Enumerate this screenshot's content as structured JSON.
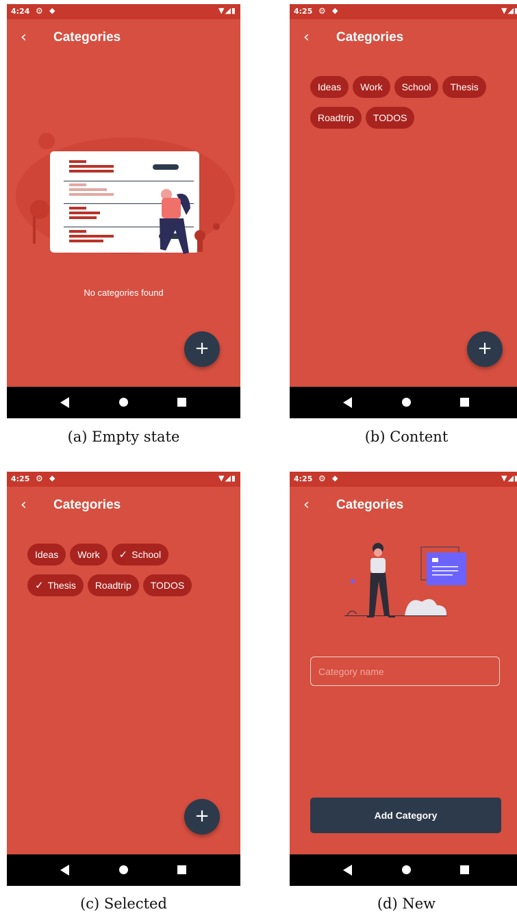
{
  "screens": [
    {
      "status_time": "4:24",
      "title": "Categories",
      "empty_message": "No categories found",
      "caption": "(a) Empty state",
      "fab_label": "+"
    },
    {
      "status_time": "4:25",
      "title": "Categories",
      "chips": [
        "Ideas",
        "Work",
        "School",
        "Thesis",
        "Roadtrip",
        "TODOS"
      ],
      "caption": "(b) Content",
      "fab_label": "+"
    },
    {
      "status_time": "4:25",
      "title": "Categories",
      "chips": [
        {
          "label": "Ideas",
          "selected": false
        },
        {
          "label": "Work",
          "selected": false
        },
        {
          "label": "School",
          "selected": true
        },
        {
          "label": "Thesis",
          "selected": true
        },
        {
          "label": "Roadtrip",
          "selected": false
        },
        {
          "label": "TODOS",
          "selected": false
        }
      ],
      "caption": "(c) Selected",
      "fab_label": "+"
    },
    {
      "status_time": "4:25",
      "title": "Categories",
      "input_placeholder": "Category name",
      "input_value": "",
      "add_button_label": "Add Category",
      "caption": "(d) New"
    }
  ],
  "icons": {
    "back": "arrow-left-icon",
    "status_settings": "gear-icon",
    "status_app": "box-icon",
    "fab": "plus-icon",
    "check": "check-icon"
  },
  "colors": {
    "background": "#d64f40",
    "status_bar": "#c6392c",
    "chip": "#a9241f",
    "fab": "#2d3a4b",
    "navbar": "#000000",
    "accent_illustration": "#6c63ff"
  }
}
